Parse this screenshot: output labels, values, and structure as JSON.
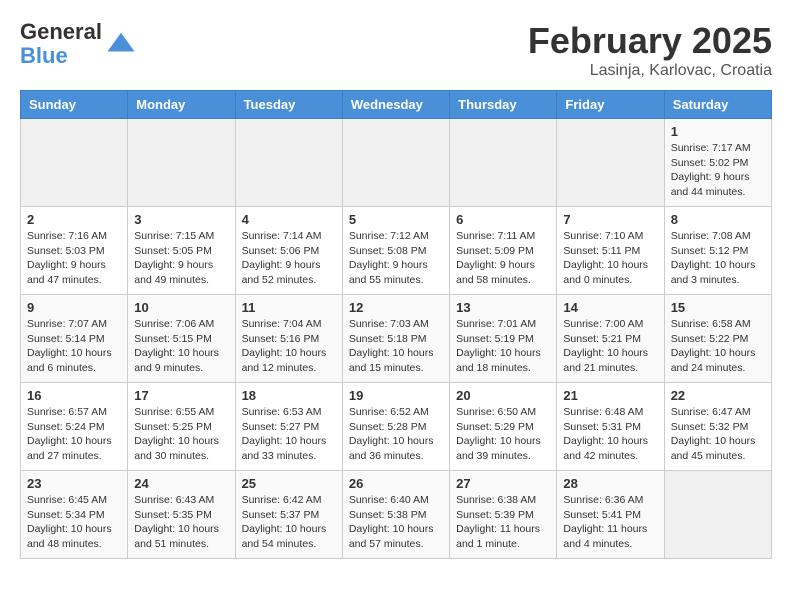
{
  "header": {
    "logo_line1": "General",
    "logo_line2": "Blue",
    "month": "February 2025",
    "location": "Lasinja, Karlovac, Croatia"
  },
  "weekdays": [
    "Sunday",
    "Monday",
    "Tuesday",
    "Wednesday",
    "Thursday",
    "Friday",
    "Saturday"
  ],
  "weeks": [
    [
      {
        "day": "",
        "info": ""
      },
      {
        "day": "",
        "info": ""
      },
      {
        "day": "",
        "info": ""
      },
      {
        "day": "",
        "info": ""
      },
      {
        "day": "",
        "info": ""
      },
      {
        "day": "",
        "info": ""
      },
      {
        "day": "1",
        "info": "Sunrise: 7:17 AM\nSunset: 5:02 PM\nDaylight: 9 hours and 44 minutes."
      }
    ],
    [
      {
        "day": "2",
        "info": "Sunrise: 7:16 AM\nSunset: 5:03 PM\nDaylight: 9 hours and 47 minutes."
      },
      {
        "day": "3",
        "info": "Sunrise: 7:15 AM\nSunset: 5:05 PM\nDaylight: 9 hours and 49 minutes."
      },
      {
        "day": "4",
        "info": "Sunrise: 7:14 AM\nSunset: 5:06 PM\nDaylight: 9 hours and 52 minutes."
      },
      {
        "day": "5",
        "info": "Sunrise: 7:12 AM\nSunset: 5:08 PM\nDaylight: 9 hours and 55 minutes."
      },
      {
        "day": "6",
        "info": "Sunrise: 7:11 AM\nSunset: 5:09 PM\nDaylight: 9 hours and 58 minutes."
      },
      {
        "day": "7",
        "info": "Sunrise: 7:10 AM\nSunset: 5:11 PM\nDaylight: 10 hours and 0 minutes."
      },
      {
        "day": "8",
        "info": "Sunrise: 7:08 AM\nSunset: 5:12 PM\nDaylight: 10 hours and 3 minutes."
      }
    ],
    [
      {
        "day": "9",
        "info": "Sunrise: 7:07 AM\nSunset: 5:14 PM\nDaylight: 10 hours and 6 minutes."
      },
      {
        "day": "10",
        "info": "Sunrise: 7:06 AM\nSunset: 5:15 PM\nDaylight: 10 hours and 9 minutes."
      },
      {
        "day": "11",
        "info": "Sunrise: 7:04 AM\nSunset: 5:16 PM\nDaylight: 10 hours and 12 minutes."
      },
      {
        "day": "12",
        "info": "Sunrise: 7:03 AM\nSunset: 5:18 PM\nDaylight: 10 hours and 15 minutes."
      },
      {
        "day": "13",
        "info": "Sunrise: 7:01 AM\nSunset: 5:19 PM\nDaylight: 10 hours and 18 minutes."
      },
      {
        "day": "14",
        "info": "Sunrise: 7:00 AM\nSunset: 5:21 PM\nDaylight: 10 hours and 21 minutes."
      },
      {
        "day": "15",
        "info": "Sunrise: 6:58 AM\nSunset: 5:22 PM\nDaylight: 10 hours and 24 minutes."
      }
    ],
    [
      {
        "day": "16",
        "info": "Sunrise: 6:57 AM\nSunset: 5:24 PM\nDaylight: 10 hours and 27 minutes."
      },
      {
        "day": "17",
        "info": "Sunrise: 6:55 AM\nSunset: 5:25 PM\nDaylight: 10 hours and 30 minutes."
      },
      {
        "day": "18",
        "info": "Sunrise: 6:53 AM\nSunset: 5:27 PM\nDaylight: 10 hours and 33 minutes."
      },
      {
        "day": "19",
        "info": "Sunrise: 6:52 AM\nSunset: 5:28 PM\nDaylight: 10 hours and 36 minutes."
      },
      {
        "day": "20",
        "info": "Sunrise: 6:50 AM\nSunset: 5:29 PM\nDaylight: 10 hours and 39 minutes."
      },
      {
        "day": "21",
        "info": "Sunrise: 6:48 AM\nSunset: 5:31 PM\nDaylight: 10 hours and 42 minutes."
      },
      {
        "day": "22",
        "info": "Sunrise: 6:47 AM\nSunset: 5:32 PM\nDaylight: 10 hours and 45 minutes."
      }
    ],
    [
      {
        "day": "23",
        "info": "Sunrise: 6:45 AM\nSunset: 5:34 PM\nDaylight: 10 hours and 48 minutes."
      },
      {
        "day": "24",
        "info": "Sunrise: 6:43 AM\nSunset: 5:35 PM\nDaylight: 10 hours and 51 minutes."
      },
      {
        "day": "25",
        "info": "Sunrise: 6:42 AM\nSunset: 5:37 PM\nDaylight: 10 hours and 54 minutes."
      },
      {
        "day": "26",
        "info": "Sunrise: 6:40 AM\nSunset: 5:38 PM\nDaylight: 10 hours and 57 minutes."
      },
      {
        "day": "27",
        "info": "Sunrise: 6:38 AM\nSunset: 5:39 PM\nDaylight: 11 hours and 1 minute."
      },
      {
        "day": "28",
        "info": "Sunrise: 6:36 AM\nSunset: 5:41 PM\nDaylight: 11 hours and 4 minutes."
      },
      {
        "day": "",
        "info": ""
      }
    ]
  ]
}
